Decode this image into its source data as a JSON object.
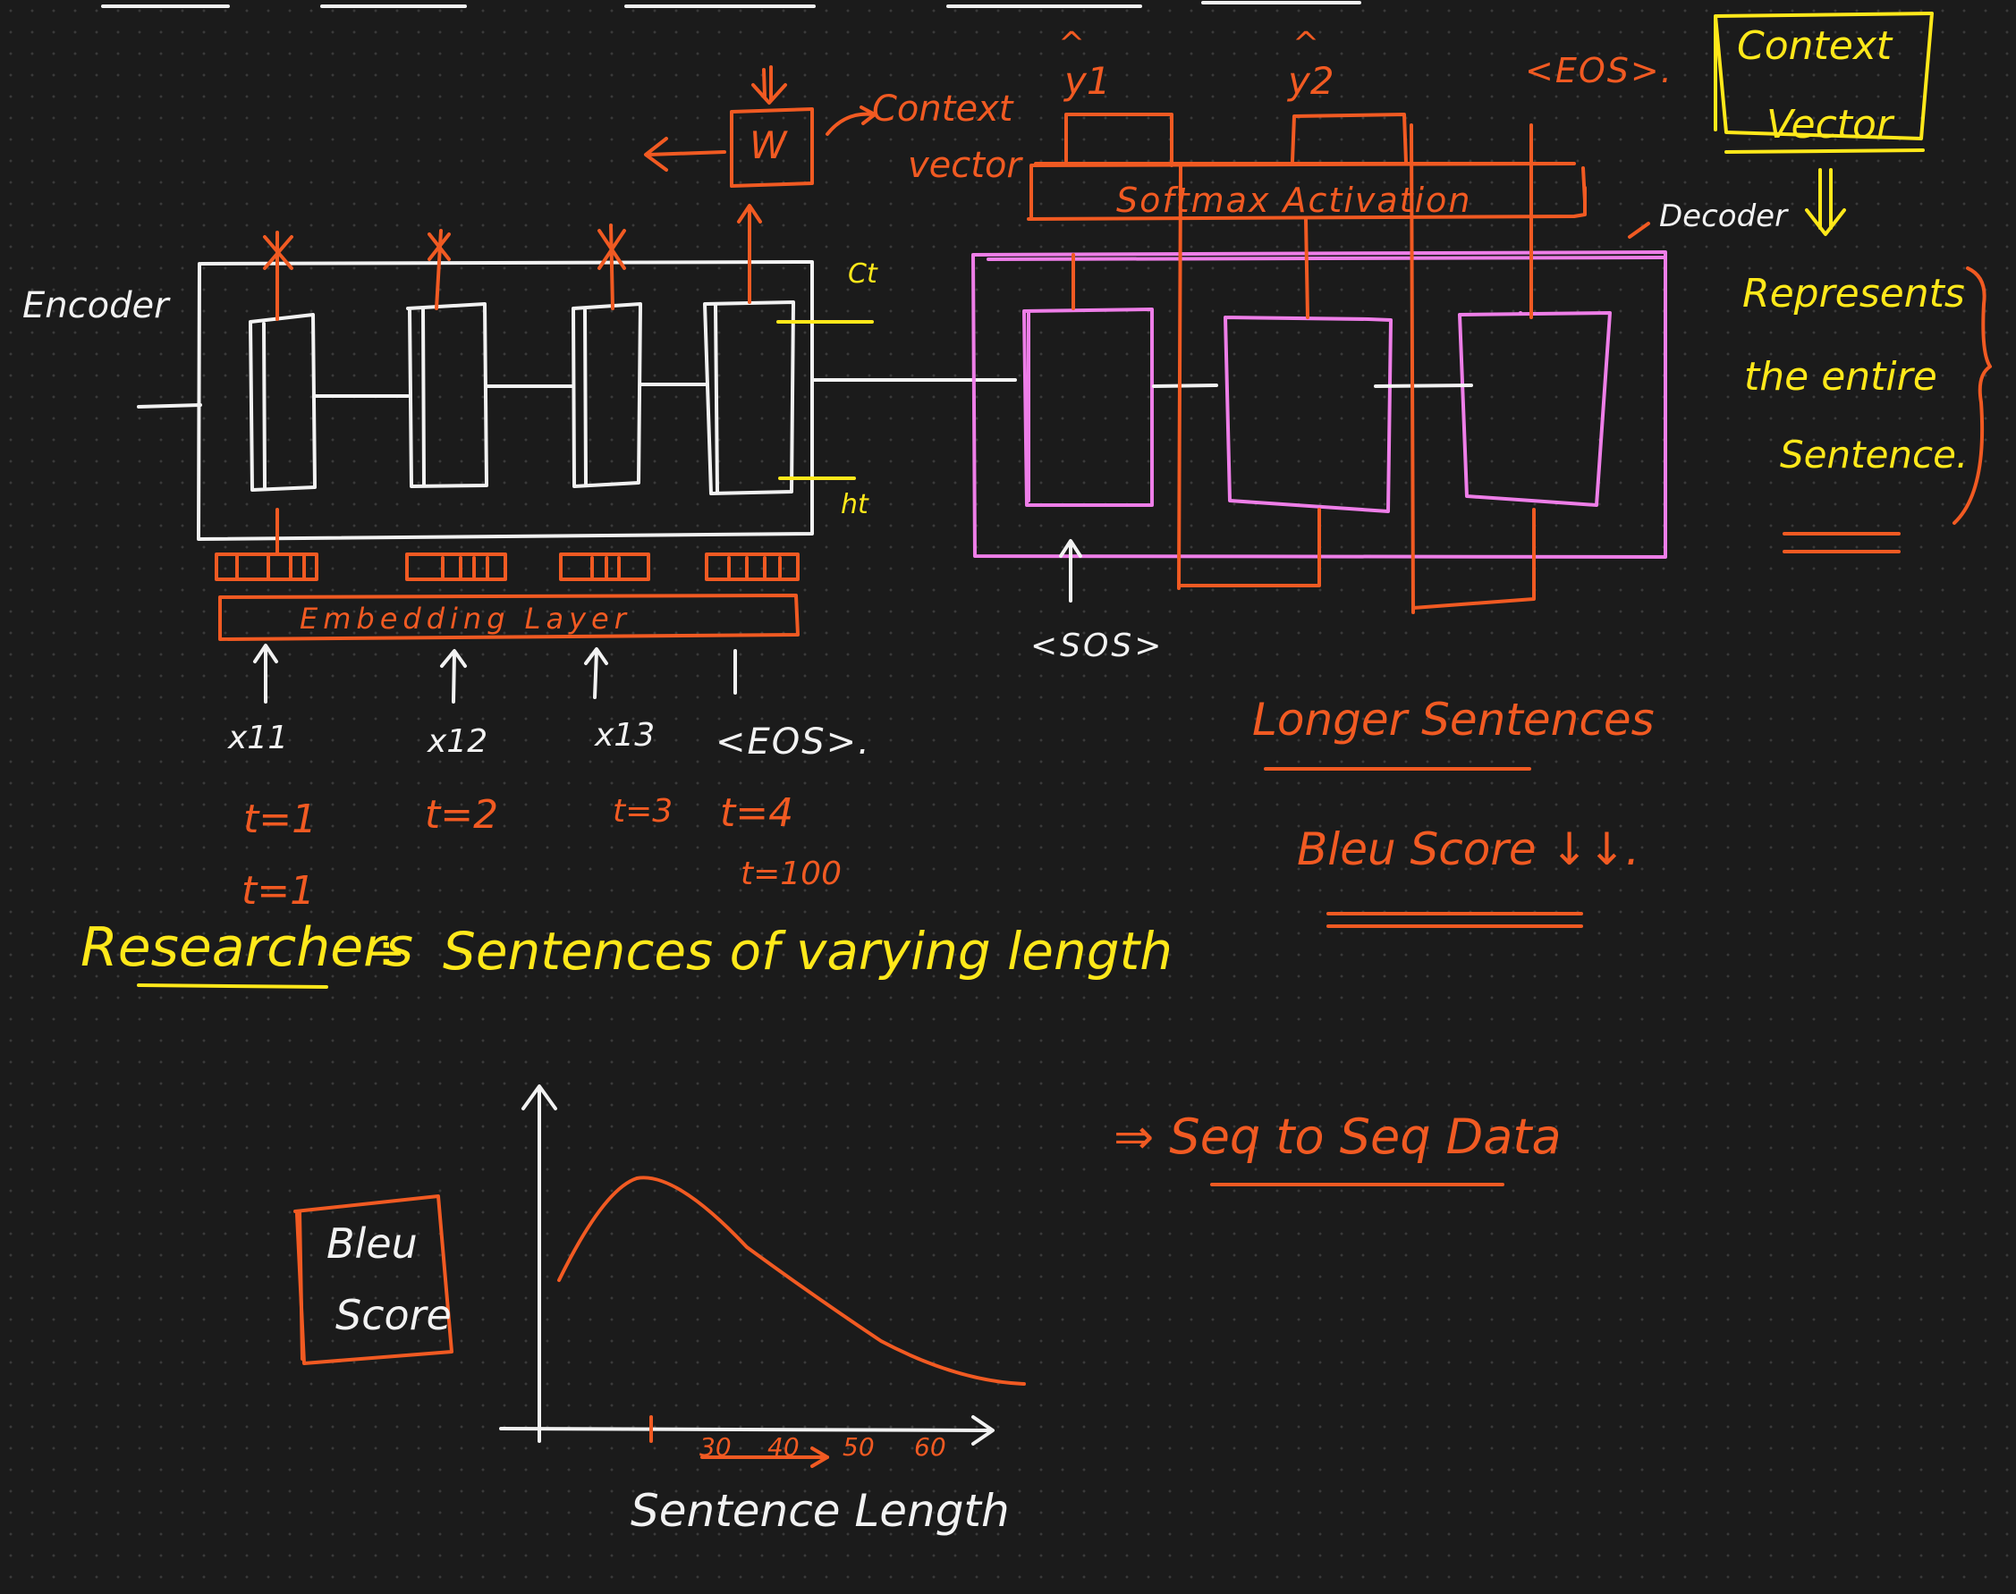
{
  "colors": {
    "background": "#1b1b1b",
    "white": "#f2f2f2",
    "orange": "#f15a22",
    "yellow": "#ffe81a",
    "pink": "#ee7ee8"
  },
  "encoder": {
    "label": "Encoder",
    "embedding_label": "Embedding Layer",
    "ct_label": "Ct",
    "ht_label": "ht",
    "inputs": [
      "x11",
      "x12",
      "x13",
      "<EOS>."
    ],
    "timesteps": [
      "t=1",
      "t=2",
      "t=3",
      "t=4"
    ],
    "extra_timesteps": [
      "t=1",
      "t=100"
    ]
  },
  "attention": {
    "w_label": "W",
    "context_note": [
      "Context",
      "vector"
    ]
  },
  "decoder": {
    "label": "Decoder",
    "softmax_label": "Softmax Activation",
    "outputs": [
      "y1",
      "y2",
      "<EOS>."
    ],
    "hat": "^",
    "sos_label": "<SOS>"
  },
  "context_vector_box": {
    "lines": [
      "Context",
      "Vector"
    ],
    "note_lines": [
      "Represents",
      "the entire",
      "Sentence."
    ]
  },
  "notes": {
    "longer_sentences": "Longer Sentences",
    "bleu_down": "Bleu Score ↓↓.",
    "researchers": "Researchers",
    "researchers_rest": "Sentences of varying length",
    "divider": "÷",
    "seq2seq": "⇒ Seq to Seq Data"
  },
  "graph": {
    "ylabel_box": [
      "Bleu",
      "Score"
    ],
    "xlabel": "Sentence Length",
    "ticks": [
      "30",
      "40",
      "50",
      "60"
    ]
  }
}
